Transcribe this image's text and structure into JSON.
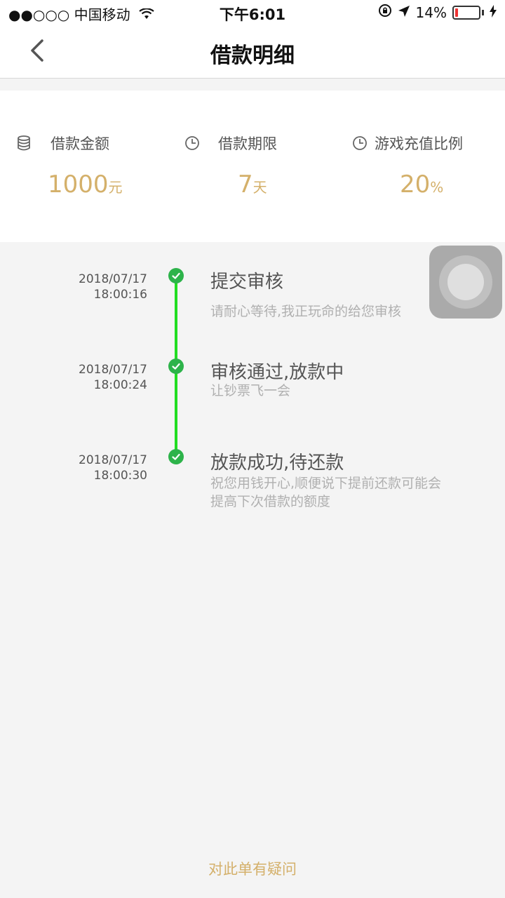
{
  "status_bar": {
    "carrier": "●●○○○ 中国移动",
    "time": "下午6:01",
    "battery": "14%",
    "battery_level_percent": 14
  },
  "nav": {
    "title": "借款明细"
  },
  "summary": [
    {
      "label": "借款金额",
      "value": "1000",
      "unit": "元",
      "icon": "coins-icon"
    },
    {
      "label": "借款期限",
      "value": "7",
      "unit": "天",
      "icon": "clock-icon"
    },
    {
      "label": "游戏充值比例",
      "value": "20",
      "unit": "%",
      "icon": "clock-icon"
    }
  ],
  "timeline": [
    {
      "date": "2018/07/17",
      "time": "18:00:16",
      "title": "提交审核",
      "desc": "请耐心等待,我正玩命的给您审核"
    },
    {
      "date": "2018/07/17",
      "time": "18:00:24",
      "title": "审核通过,放款中",
      "desc": "让钞票飞一会"
    },
    {
      "date": "2018/07/17",
      "time": "18:00:30",
      "title": "放款成功,待还款",
      "desc": "祝您用钱开心,顺便说下提前还款可能会提高下次借款的额度"
    }
  ],
  "footer": {
    "link": "对此单有疑问"
  },
  "colors": {
    "gold": "#d4b06a",
    "green_check": "#2db34a",
    "green_line": "#22dd22"
  }
}
